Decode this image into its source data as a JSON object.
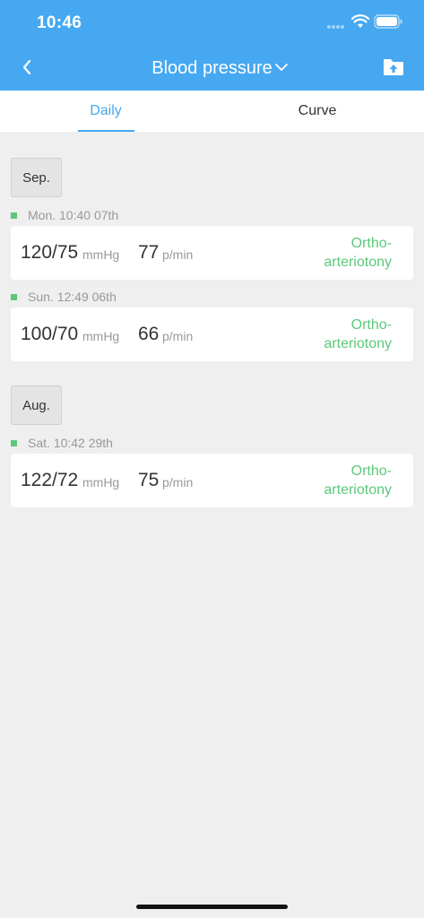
{
  "status_bar": {
    "time": "10:46"
  },
  "header": {
    "title": "Blood pressure"
  },
  "tabs": [
    {
      "label": "Daily",
      "active": true
    },
    {
      "label": "Curve",
      "active": false
    }
  ],
  "groups": [
    {
      "month": "Sep.",
      "entries": [
        {
          "date": "Mon. 10:40 07th",
          "bp": "120/75",
          "bp_unit": "mmHg",
          "pulse": "77",
          "pulse_unit": "p/min",
          "status": "Ortho-\narteriotony"
        },
        {
          "date": "Sun. 12:49 06th",
          "bp": "100/70",
          "bp_unit": "mmHg",
          "pulse": "66",
          "pulse_unit": "p/min",
          "status": "Ortho-\narteriotony"
        }
      ]
    },
    {
      "month": "Aug.",
      "entries": [
        {
          "date": "Sat. 10:42 29th",
          "bp": "122/72",
          "bp_unit": "mmHg",
          "pulse": "75",
          "pulse_unit": "p/min",
          "status": "Ortho-\narteriotony"
        }
      ]
    }
  ],
  "colors": {
    "primary": "#46a8f0",
    "status_normal": "#5cc87a",
    "background": "#efefef"
  },
  "icons": {
    "back": "chevron-left-icon",
    "dropdown": "chevron-down-icon",
    "upload": "folder-upload-icon"
  }
}
